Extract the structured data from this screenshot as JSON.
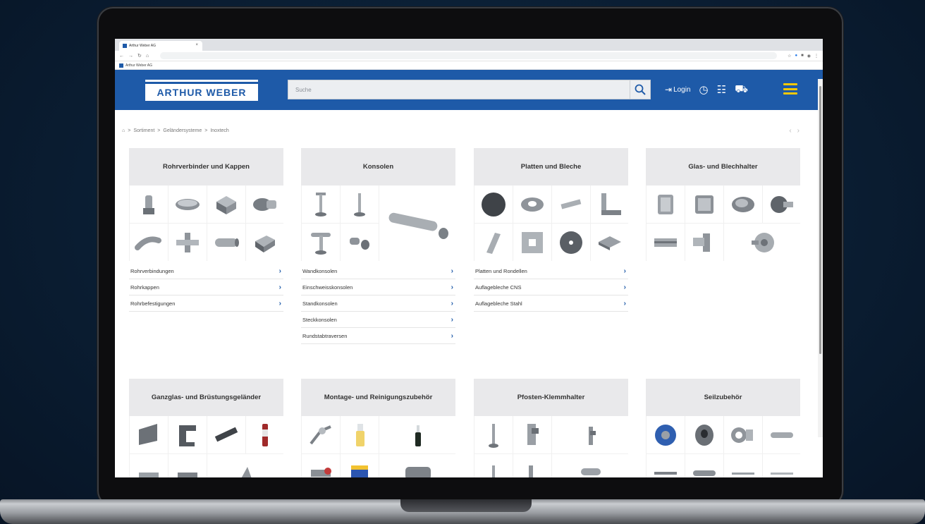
{
  "browser": {
    "tab_title": "Arthur Weber AG",
    "tab_close": "×",
    "bookmark": "Arthur Weber AG"
  },
  "header": {
    "logo": "ARTHUR WEBER",
    "search_placeholder": "Suche",
    "login_label": "Login"
  },
  "breadcrumb": [
    "Sortiment",
    "Geländersysteme",
    "Inoxtech"
  ],
  "categories": [
    {
      "title": "Rohrverbinder und Kappen",
      "links": [
        "Rohrverbindungen",
        "Rohrkappen",
        "Rohrbefestigungen"
      ]
    },
    {
      "title": "Konsolen",
      "links": [
        "Wandkonsolen",
        "Einschweisskonsolen",
        "Standkonsolen",
        "Steckkonsolen",
        "Rundstabtraversen"
      ]
    },
    {
      "title": "Platten und Bleche",
      "links": [
        "Platten und Rondellen",
        "Auflagebleche CNS",
        "Auflagebleche Stahl"
      ]
    },
    {
      "title": "Glas- und Blechhalter",
      "links": []
    },
    {
      "title": "Ganzglas- und Brüstungsgeländer",
      "links": []
    },
    {
      "title": "Montage- und Reinigungszubehör",
      "links": []
    },
    {
      "title": "Pfosten-Klemmhalter",
      "links": []
    },
    {
      "title": "Seilzubehör",
      "links": []
    }
  ],
  "colors": {
    "brand_blue": "#1e5aa8",
    "menu_yellow": "#f7c800",
    "card_header": "#e9e9eb"
  }
}
